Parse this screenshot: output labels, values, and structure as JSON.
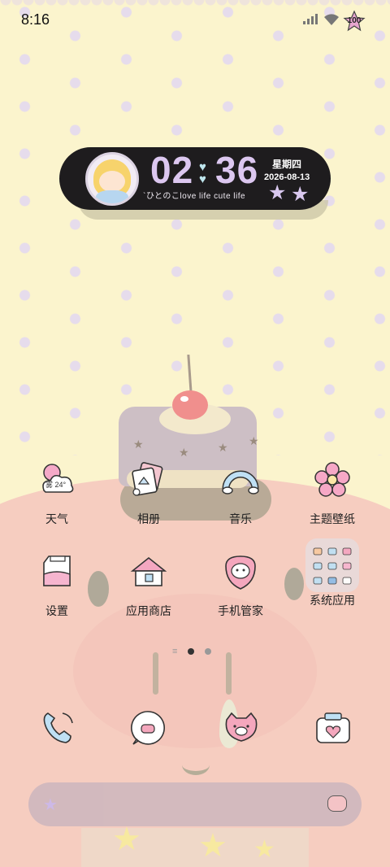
{
  "status_bar": {
    "time": "8:16",
    "battery": "100"
  },
  "widget": {
    "hours": "02",
    "minutes": "36",
    "weekday": "星期四",
    "date": "2026-08-13",
    "slogan": "`ひとのこlove life cute life"
  },
  "apps": [
    {
      "label": "天气",
      "icon": "weather-icon",
      "weather_text": "雾 24°"
    },
    {
      "label": "相册",
      "icon": "gallery-icon"
    },
    {
      "label": "音乐",
      "icon": "music-icon"
    },
    {
      "label": "主题壁纸",
      "icon": "theme-icon"
    },
    {
      "label": "设置",
      "icon": "settings-icon"
    },
    {
      "label": "应用商店",
      "icon": "app-store-icon"
    },
    {
      "label": "手机管家",
      "icon": "phone-manager-icon"
    },
    {
      "label": "系统应用",
      "icon": "system-apps-folder-icon"
    }
  ],
  "dock": [
    {
      "icon": "phone-icon"
    },
    {
      "icon": "messages-icon"
    },
    {
      "icon": "browser-icon"
    },
    {
      "icon": "camera-icon"
    }
  ],
  "page_indicator": {
    "pages": 2,
    "current": 1
  },
  "colors": {
    "wallpaper": "#fbf4cd",
    "widget_bg": "#1e1c1e",
    "clock": "#dcc7f0"
  }
}
